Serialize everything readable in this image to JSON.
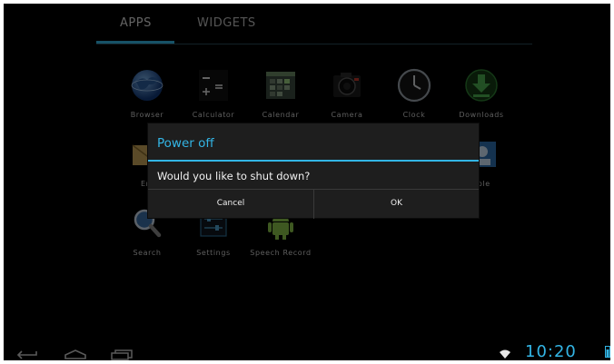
{
  "tabs": {
    "apps": "APPS",
    "widgets": "WIDGETS"
  },
  "apps": [
    {
      "label": "Browser"
    },
    {
      "label": "Calculator"
    },
    {
      "label": "Calendar"
    },
    {
      "label": "Camera"
    },
    {
      "label": "Clock"
    },
    {
      "label": "Downloads"
    },
    {
      "label": "Em"
    },
    {
      "label": "ople"
    },
    {
      "label": "Search"
    },
    {
      "label": "Settings"
    },
    {
      "label": "Speech Record"
    }
  ],
  "dialog": {
    "title": "Power off",
    "message": "Would you like to shut down?",
    "cancel_label": "Cancel",
    "ok_label": "OK"
  },
  "status": {
    "time": "10:20"
  },
  "colors": {
    "accent": "#33b5e5",
    "background": "#000000",
    "dialog": "#1e1e1e"
  },
  "icons": [
    "back-icon",
    "home-icon",
    "recent-apps-icon",
    "wifi-icon",
    "battery-icon"
  ]
}
